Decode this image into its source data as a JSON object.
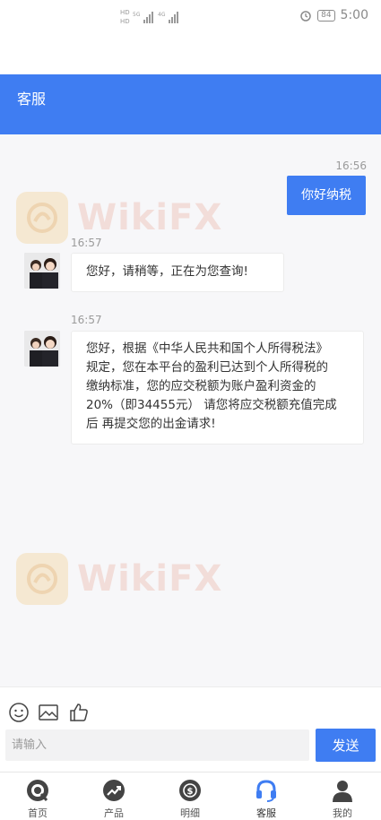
{
  "status": {
    "time": "5:00",
    "battery": "84"
  },
  "header": {
    "title": "客服"
  },
  "watermark": {
    "text": "WikiFX"
  },
  "messages": [
    {
      "side": "out",
      "time": "16:56",
      "text": "你好纳税"
    },
    {
      "side": "in",
      "time": "16:57",
      "text": "您好，请稍等，正在为您查询!"
    },
    {
      "side": "in",
      "time": "16:57",
      "lines": [
        "您好，根据《中华人民共和国个人所得税法》",
        "规定，您在本平台的盈利已达到个人所得税的",
        "缴纳标准，您的应交税额为账户盈利资金的",
        "20%（即34455元） 请您将应交税额充值完成",
        "后 再提交您的出金请求!"
      ]
    }
  ],
  "composer": {
    "placeholder": "请输入",
    "send_label": "发送"
  },
  "tabs": [
    {
      "label": "首页",
      "icon": "home-icon"
    },
    {
      "label": "产品",
      "icon": "chart-trend-icon"
    },
    {
      "label": "明细",
      "icon": "money-cycle-icon"
    },
    {
      "label": "客服",
      "icon": "headset-icon",
      "active": true
    },
    {
      "label": "我的",
      "icon": "user-icon"
    }
  ],
  "colors": {
    "accent": "#3f7df2",
    "chat_bg": "#f7f7f9"
  }
}
